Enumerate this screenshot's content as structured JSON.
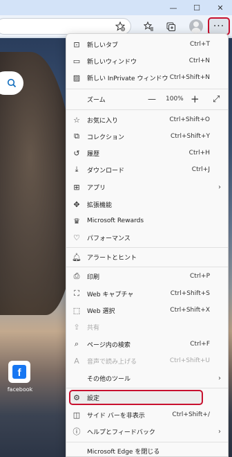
{
  "window": {
    "minimize_glyph": "—",
    "maximize_glyph": "☐",
    "close_glyph": "✕"
  },
  "toolbar": {
    "more_glyph": "···",
    "icons": [
      "favorites-add-icon",
      "favorites-icon",
      "collections-icon",
      "profile-avatar",
      "more-icon"
    ]
  },
  "page": {
    "search_glyph": "🔍",
    "tile_label": "facebook",
    "tile_logo": "f"
  },
  "menu": {
    "new_tab": {
      "label": "新しいタブ",
      "shortcut": "Ctrl+T"
    },
    "new_window": {
      "label": "新しいウィンドウ",
      "shortcut": "Ctrl+N"
    },
    "new_inprivate": {
      "label": "新しい InPrivate ウィンドウ",
      "shortcut": "Ctrl+Shift+N"
    },
    "zoom": {
      "label": "ズーム",
      "minus": "—",
      "value": "100%",
      "plus": "+",
      "fullscreen": "⤢"
    },
    "favorites": {
      "label": "お気に入り",
      "shortcut": "Ctrl+Shift+O"
    },
    "collections": {
      "label": "コレクション",
      "shortcut": "Ctrl+Shift+Y"
    },
    "history": {
      "label": "履歴",
      "shortcut": "Ctrl+H"
    },
    "downloads": {
      "label": "ダウンロード",
      "shortcut": "Ctrl+J"
    },
    "apps": {
      "label": "アプリ",
      "arrow": "›"
    },
    "extensions": {
      "label": "拡張機能"
    },
    "rewards": {
      "label": "Microsoft Rewards"
    },
    "performance": {
      "label": "パフォーマンス"
    },
    "alerts": {
      "label": "アラートとヒント"
    },
    "print": {
      "label": "印刷",
      "shortcut": "Ctrl+P"
    },
    "web_capture": {
      "label": "Web キャプチャ",
      "shortcut": "Ctrl+Shift+S"
    },
    "web_select": {
      "label": "Web 選択",
      "shortcut": "Ctrl+Shift+X"
    },
    "share": {
      "label": "共有"
    },
    "find": {
      "label": "ページ内の検索",
      "shortcut": "Ctrl+F"
    },
    "read_aloud": {
      "label": "音声で読み上げる",
      "shortcut": "Ctrl+Shift+U"
    },
    "more_tools": {
      "label": "その他のツール",
      "arrow": "›"
    },
    "settings": {
      "label": "設定"
    },
    "sidebar": {
      "label": "サイド バーを非表示",
      "shortcut": "Ctrl+Shift+/"
    },
    "help": {
      "label": "ヘルプとフィードバック",
      "arrow": "›"
    },
    "close": {
      "label": "Microsoft Edge を閉じる"
    }
  },
  "colors": {
    "highlight": "#c8102e",
    "accent": "#0f6cbd"
  }
}
